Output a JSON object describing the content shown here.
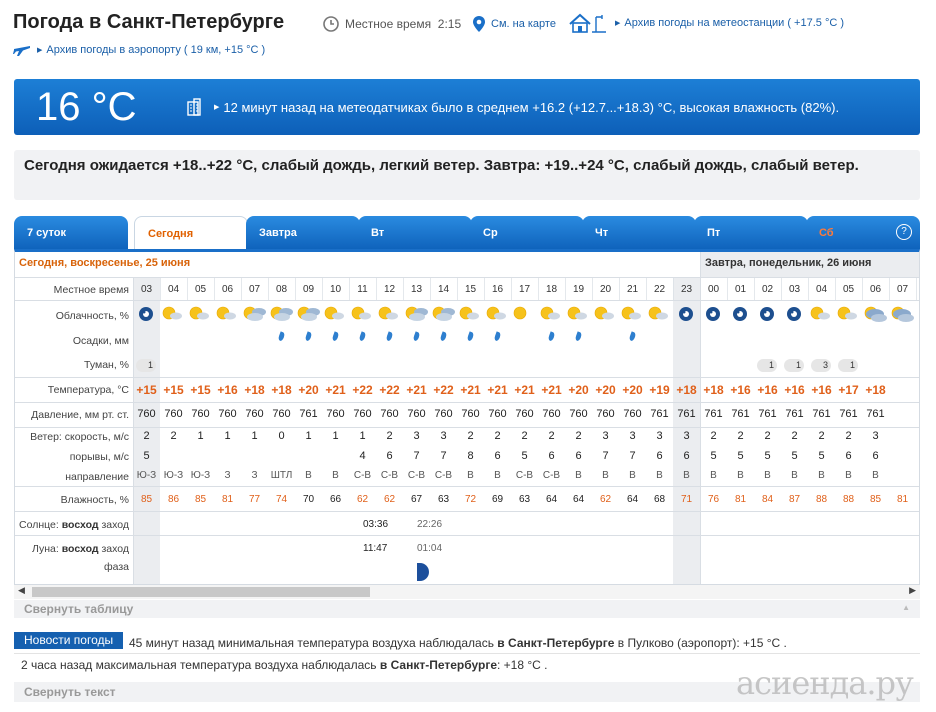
{
  "header": {
    "title": "Погода в Санкт-Петербурге",
    "local_time_label": "Местное время",
    "local_time": "2:15",
    "map_link": "См. на карте",
    "archive_station_link": "Архив погоды на метеостанции ( +17.5 °C )",
    "archive_airport_link": "Архив погоды в аэропорту ( 19 км, +15 °C )"
  },
  "current": {
    "temp": "16 °C",
    "message": "12 минут назад на метеодатчиках было в среднем +16.2 (+12.7...+18.3) °C, высокая влажность (82%)."
  },
  "forecast_text": "Сегодня ожидается +18..+22 °C, слабый дождь, легкий ветер. Завтра: +19..+24 °C, слабый дождь, слабый ветер.",
  "tabs": [
    {
      "label": "7 суток"
    },
    {
      "label": "Сегодня",
      "active": true
    },
    {
      "label": "Завтра"
    },
    {
      "label": "Вт"
    },
    {
      "label": "Ср"
    },
    {
      "label": "Чт"
    },
    {
      "label": "Пт"
    },
    {
      "label": "Сб"
    }
  ],
  "help": "?",
  "table": {
    "today_header": "Сегодня, воскресенье, 25 июня",
    "tomorrow_header": "Завтра, понедельник, 26 июня",
    "row_labels": {
      "time": "Местное время",
      "cloud": "Облачность, %",
      "precip": "Осадки, мм",
      "fog": "Туман, %",
      "temp": "Температура, °C",
      "pressure": "Давление, мм рт. ст.",
      "wind": "Ветер: скорость, м/с",
      "gusts": "порывы, м/с",
      "direction": "направление",
      "humidity": "Влажность, %",
      "sun_a": "Солнце:",
      "sun_b": "восход",
      "sun_c": "заход",
      "moon_a": "Луна:",
      "moon_b": "восход",
      "moon_c": "заход",
      "phase": "фаза"
    },
    "hours": [
      "03",
      "04",
      "05",
      "06",
      "07",
      "08",
      "09",
      "10",
      "11",
      "12",
      "13",
      "14",
      "15",
      "16",
      "17",
      "18",
      "19",
      "20",
      "21",
      "22",
      "23",
      "00",
      "01",
      "02",
      "03",
      "04",
      "05",
      "06",
      "07"
    ],
    "clouds": [
      "n-moon",
      "sun-c",
      "sun-c",
      "sun-c",
      "sun-cc",
      "sun-cc",
      "sun-cc",
      "sun-c",
      "sun-c",
      "sun-c",
      "sun-cc",
      "sun-cc",
      "sun-c",
      "sun-c",
      "sun",
      "sun-c",
      "sun-c",
      "sun-c",
      "sun-c",
      "sun-c",
      "n-moon",
      "n-moon",
      "n-moon",
      "n-moon",
      "n-moon",
      "sun-c",
      "sun-c",
      "sun-ccc",
      "sun-ccc"
    ],
    "precip": [
      0,
      0,
      0,
      0,
      0,
      1,
      1,
      1,
      1,
      1,
      1,
      1,
      1,
      1,
      0,
      1,
      1,
      0,
      1,
      0,
      0,
      0,
      0,
      0,
      0,
      0,
      0,
      0,
      0
    ],
    "fog": [
      "1",
      "",
      "",
      "",
      "",
      "",
      "",
      "",
      "",
      "",
      "",
      "",
      "",
      "",
      "",
      "",
      "",
      "",
      "",
      "",
      "",
      "",
      "",
      "1",
      "1",
      "3",
      "1",
      "",
      ""
    ],
    "temp": [
      "+15",
      "+15",
      "+15",
      "+16",
      "+18",
      "+18",
      "+20",
      "+21",
      "+22",
      "+22",
      "+21",
      "+22",
      "+21",
      "+21",
      "+21",
      "+21",
      "+20",
      "+20",
      "+20",
      "+19",
      "+18",
      "+18",
      "+16",
      "+16",
      "+16",
      "+16",
      "+17",
      "+18"
    ],
    "pressure": [
      "760",
      "760",
      "760",
      "760",
      "760",
      "760",
      "761",
      "760",
      "760",
      "760",
      "760",
      "760",
      "760",
      "760",
      "760",
      "760",
      "760",
      "760",
      "760",
      "761",
      "761",
      "761",
      "761",
      "761",
      "761",
      "761",
      "761",
      "761"
    ],
    "wind": [
      "2",
      "2",
      "1",
      "1",
      "1",
      "0",
      "1",
      "1",
      "1",
      "2",
      "3",
      "3",
      "2",
      "2",
      "2",
      "2",
      "2",
      "3",
      "3",
      "3",
      "3",
      "2",
      "2",
      "2",
      "2",
      "2",
      "2",
      "3"
    ],
    "gusts": [
      "5",
      "",
      "",
      "",
      "",
      "",
      "",
      "",
      "4",
      "6",
      "7",
      "7",
      "8",
      "6",
      "5",
      "6",
      "6",
      "7",
      "7",
      "6",
      "6",
      "5",
      "5",
      "5",
      "5",
      "5",
      "6",
      "6"
    ],
    "direction": [
      "Ю-З",
      "Ю-З",
      "Ю-З",
      "З",
      "З",
      "ШТЛ",
      "В",
      "В",
      "С-В",
      "С-В",
      "С-В",
      "С-В",
      "В",
      "В",
      "С-В",
      "С-В",
      "В",
      "В",
      "В",
      "В",
      "В",
      "В",
      "В",
      "В",
      "В",
      "В",
      "В",
      "В"
    ],
    "humidity": [
      "85",
      "86",
      "85",
      "81",
      "77",
      "74",
      "70",
      "66",
      "62",
      "62",
      "67",
      "63",
      "72",
      "69",
      "63",
      "64",
      "64",
      "62",
      "64",
      "68",
      "71",
      "76",
      "81",
      "84",
      "87",
      "88",
      "88",
      "85",
      "81"
    ],
    "sunrise": "03:36",
    "sunset": "22:26",
    "moonrise": "11:47",
    "moonset": "01:04"
  },
  "collapse_table": "Свернуть таблицу",
  "news": {
    "badge": "Новости погоды",
    "line1_pre": "45 минут назад минимальная температура воздуха наблюдалась ",
    "line1_city": "в Санкт-Петербурге",
    "line1_post": " в Пулково (аэропорт): +15 °C .",
    "line2_pre": "2 часа назад максимальная температура воздуха наблюдалась ",
    "line2_city": "в Санкт-Петербурге",
    "line2_post": ": +18 °C .",
    "collapse": "Свернуть текст"
  },
  "watermark": "асиенда.ру",
  "colors": {
    "accent": "#1a6fc8",
    "temp": "#e0601a",
    "today": "#d8630a"
  }
}
